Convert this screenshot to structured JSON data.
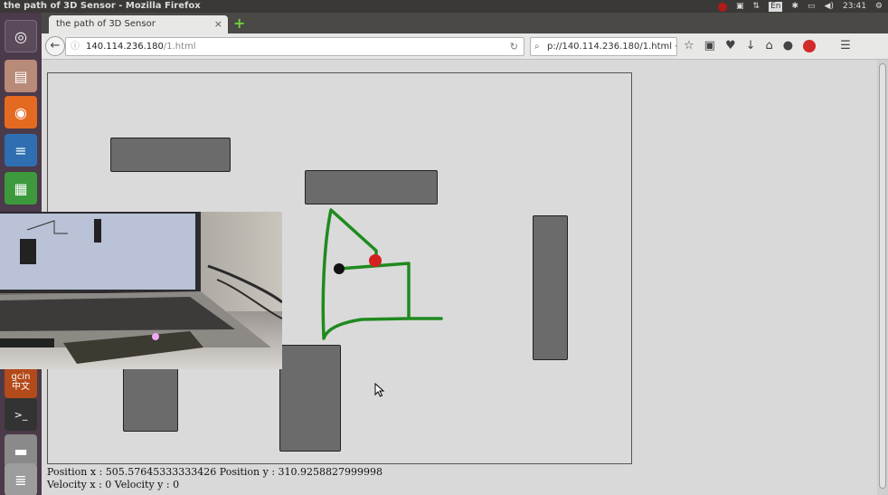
{
  "system_bar": {
    "window_title": "the path of 3D Sensor - Mozilla Firefox",
    "keyboard": "En",
    "clock": "23:41"
  },
  "launcher": {
    "items": [
      "ubuntu-dash-icon",
      "files-icon",
      "firefox-icon",
      "writer-icon",
      "calc-icon",
      "input-method-icon",
      "terminal-icon",
      "trash-icon"
    ],
    "input_method_label": "gcin",
    "input_method_sublabel": "中文"
  },
  "browser": {
    "tab_title": "the path of 3D Sensor",
    "tab_close": "×",
    "new_tab": "+",
    "url_host": "140.114.236.180",
    "url_path": "/1.html",
    "search_text": "p://140.114.236.180/1.html →"
  },
  "page": {
    "position_text": "Position x : 505.57645333333426 Position y : 310.9258827999998",
    "velocity_text": "Velocity x : 0 Velocity y : 0"
  },
  "colors": {
    "path": "#1f8a1f",
    "current_point": "#d42020",
    "start_point": "#111111",
    "obstacle": "#6b6b6b"
  }
}
